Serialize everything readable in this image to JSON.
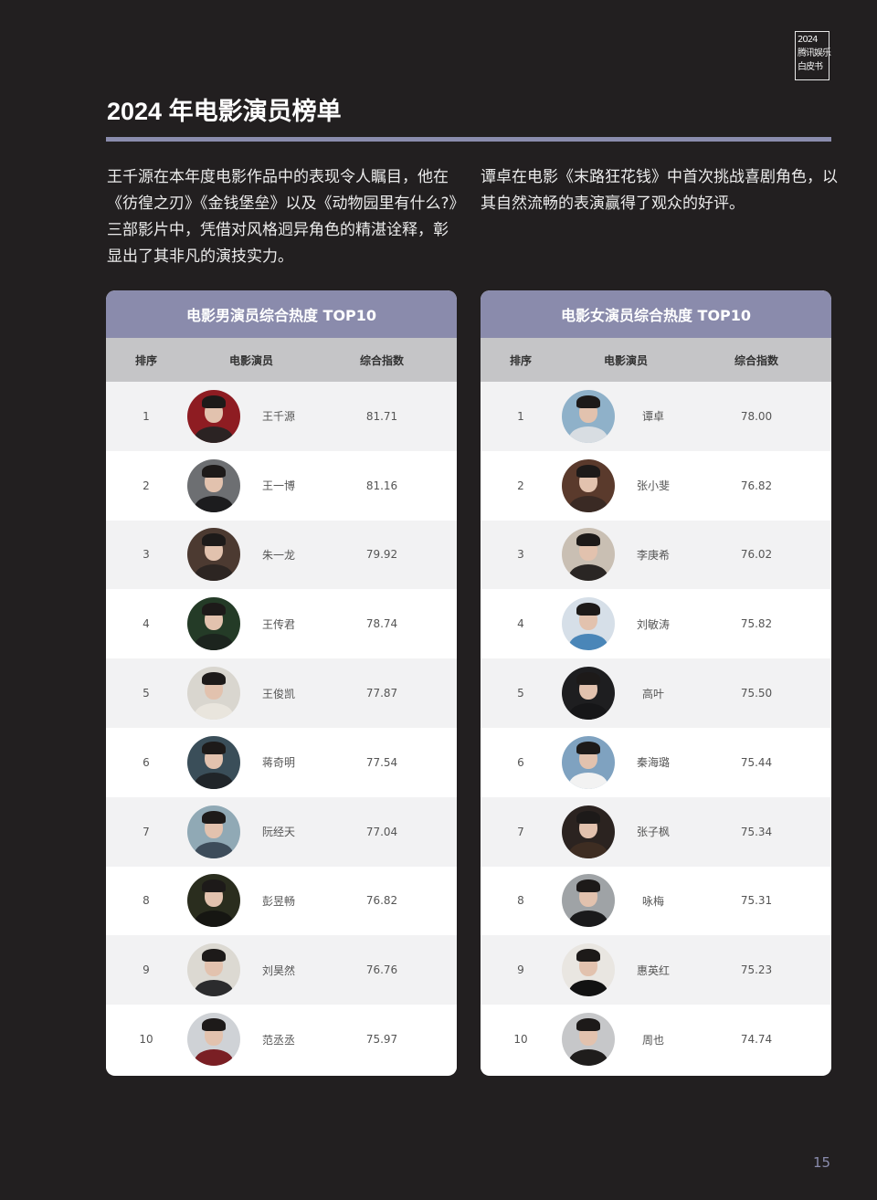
{
  "logo": {
    "line1": "2024",
    "line2": "腾讯娱乐",
    "line3": "白皮书"
  },
  "title": "2024 年电影演员榜单",
  "intro": {
    "left": "王千源在本年度电影作品中的表现令人瞩目，他在《彷徨之刃》《金钱堡垒》以及《动物园里有什么?》三部影片中，凭借对风格迥异角色的精湛诠释，彰显出了其非凡的演技实力。",
    "right": "谭卓在电影《末路狂花钱》中首次挑战喜剧角色，以其自然流畅的表演赢得了观众的好评。"
  },
  "columns": {
    "rank": "排序",
    "actor": "电影演员",
    "score": "综合指数"
  },
  "male": {
    "title": "电影男演员综合热度 TOP10",
    "rows": [
      {
        "rank": "1",
        "name": "王千源",
        "score": "81.71",
        "bg": "#8e1c22",
        "coat": "#2b2323"
      },
      {
        "rank": "2",
        "name": "王一博",
        "score": "81.16",
        "bg": "#6d6f72",
        "coat": "#1c1c1e"
      },
      {
        "rank": "3",
        "name": "朱一龙",
        "score": "79.92",
        "bg": "#4c3a31",
        "coat": "#2c2522"
      },
      {
        "rank": "4",
        "name": "王传君",
        "score": "78.74",
        "bg": "#243b27",
        "coat": "#1c241e"
      },
      {
        "rank": "5",
        "name": "王俊凯",
        "score": "77.87",
        "bg": "#d9d6cf",
        "coat": "#e9e5dd"
      },
      {
        "rank": "6",
        "name": "蒋奇明",
        "score": "77.54",
        "bg": "#3a4e59",
        "coat": "#202529"
      },
      {
        "rank": "7",
        "name": "阮经天",
        "score": "77.04",
        "bg": "#90a9b5",
        "coat": "#3d4c5a"
      },
      {
        "rank": "8",
        "name": "彭昱畅",
        "score": "76.82",
        "bg": "#2a2d1e",
        "coat": "#161612"
      },
      {
        "rank": "9",
        "name": "刘昊然",
        "score": "76.76",
        "bg": "#dcd9d2",
        "coat": "#2b2b2d"
      },
      {
        "rank": "10",
        "name": "范丞丞",
        "score": "75.97",
        "bg": "#cfd2d6",
        "coat": "#7a1f24"
      }
    ]
  },
  "female": {
    "title": "电影女演员综合热度 TOP10",
    "rows": [
      {
        "rank": "1",
        "name": "谭卓",
        "score": "78.00",
        "bg": "#8fb1c9",
        "coat": "#d8dde2"
      },
      {
        "rank": "2",
        "name": "张小斐",
        "score": "76.82",
        "bg": "#5a3a2c",
        "coat": "#3a2a24"
      },
      {
        "rank": "3",
        "name": "李庚希",
        "score": "76.02",
        "bg": "#c9bfb3",
        "coat": "#2a2624"
      },
      {
        "rank": "4",
        "name": "刘敏涛",
        "score": "75.82",
        "bg": "#d6dfe8",
        "coat": "#4a86b8"
      },
      {
        "rank": "5",
        "name": "高叶",
        "score": "75.50",
        "bg": "#1e1e20",
        "coat": "#161618"
      },
      {
        "rank": "6",
        "name": "秦海璐",
        "score": "75.44",
        "bg": "#7fa2c0",
        "coat": "#f2f2f2"
      },
      {
        "rank": "7",
        "name": "张子枫",
        "score": "75.34",
        "bg": "#2b2320",
        "coat": "#3e2d22"
      },
      {
        "rank": "8",
        "name": "咏梅",
        "score": "75.31",
        "bg": "#9fa3a6",
        "coat": "#1a1a1c"
      },
      {
        "rank": "9",
        "name": "惠英红",
        "score": "75.23",
        "bg": "#e9e6e1",
        "coat": "#121212"
      },
      {
        "rank": "10",
        "name": "周也",
        "score": "74.74",
        "bg": "#c6c7c9",
        "coat": "#1f1d1c"
      }
    ]
  },
  "page_number": "15"
}
